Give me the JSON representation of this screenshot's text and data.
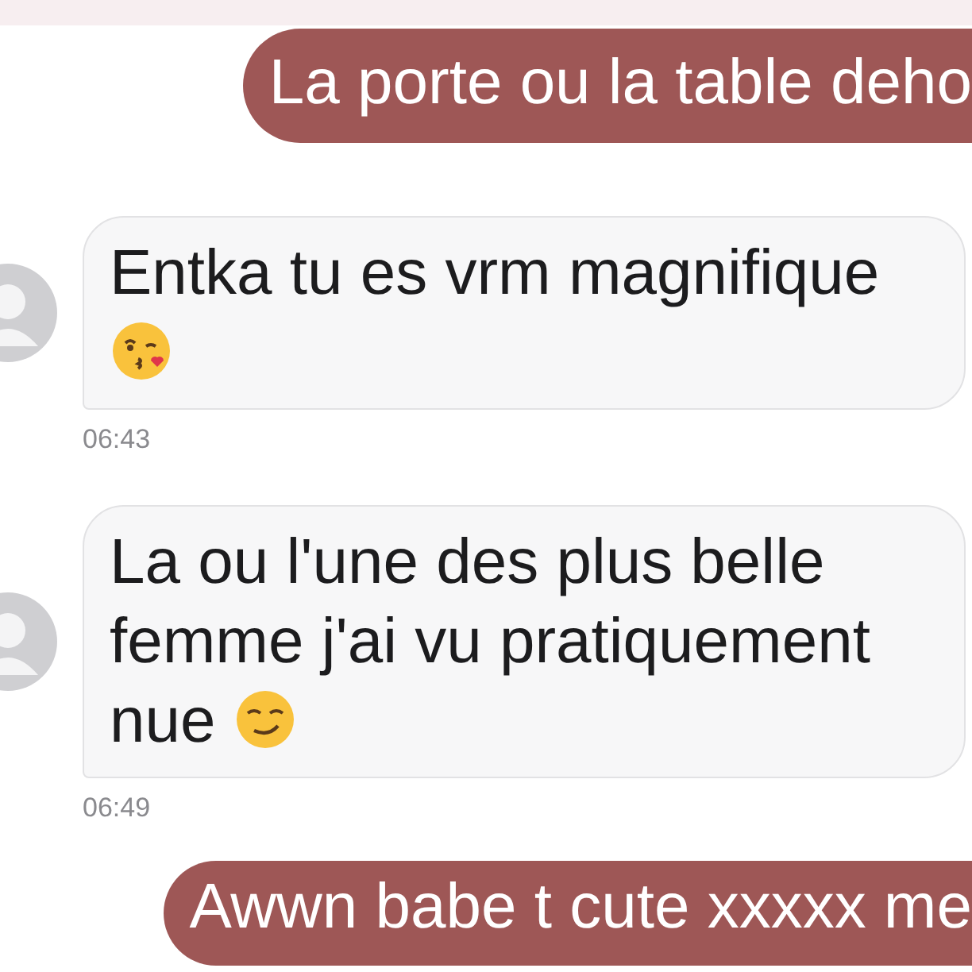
{
  "messages": [
    {
      "kind": "sent",
      "text": "La porte ou la table deho"
    },
    {
      "kind": "received",
      "text": "Entka tu es vrm magnifique",
      "emoji": {
        "kind": "kiss"
      },
      "time": "06:43"
    },
    {
      "kind": "received",
      "text": "La ou l'une des plus belle femme j'ai vu pratiquement nue",
      "emoji": {
        "kind": "smirk"
      },
      "time": "06:49"
    },
    {
      "kind": "sent",
      "text": "Awwn babe t cute xxxxx me"
    }
  ]
}
